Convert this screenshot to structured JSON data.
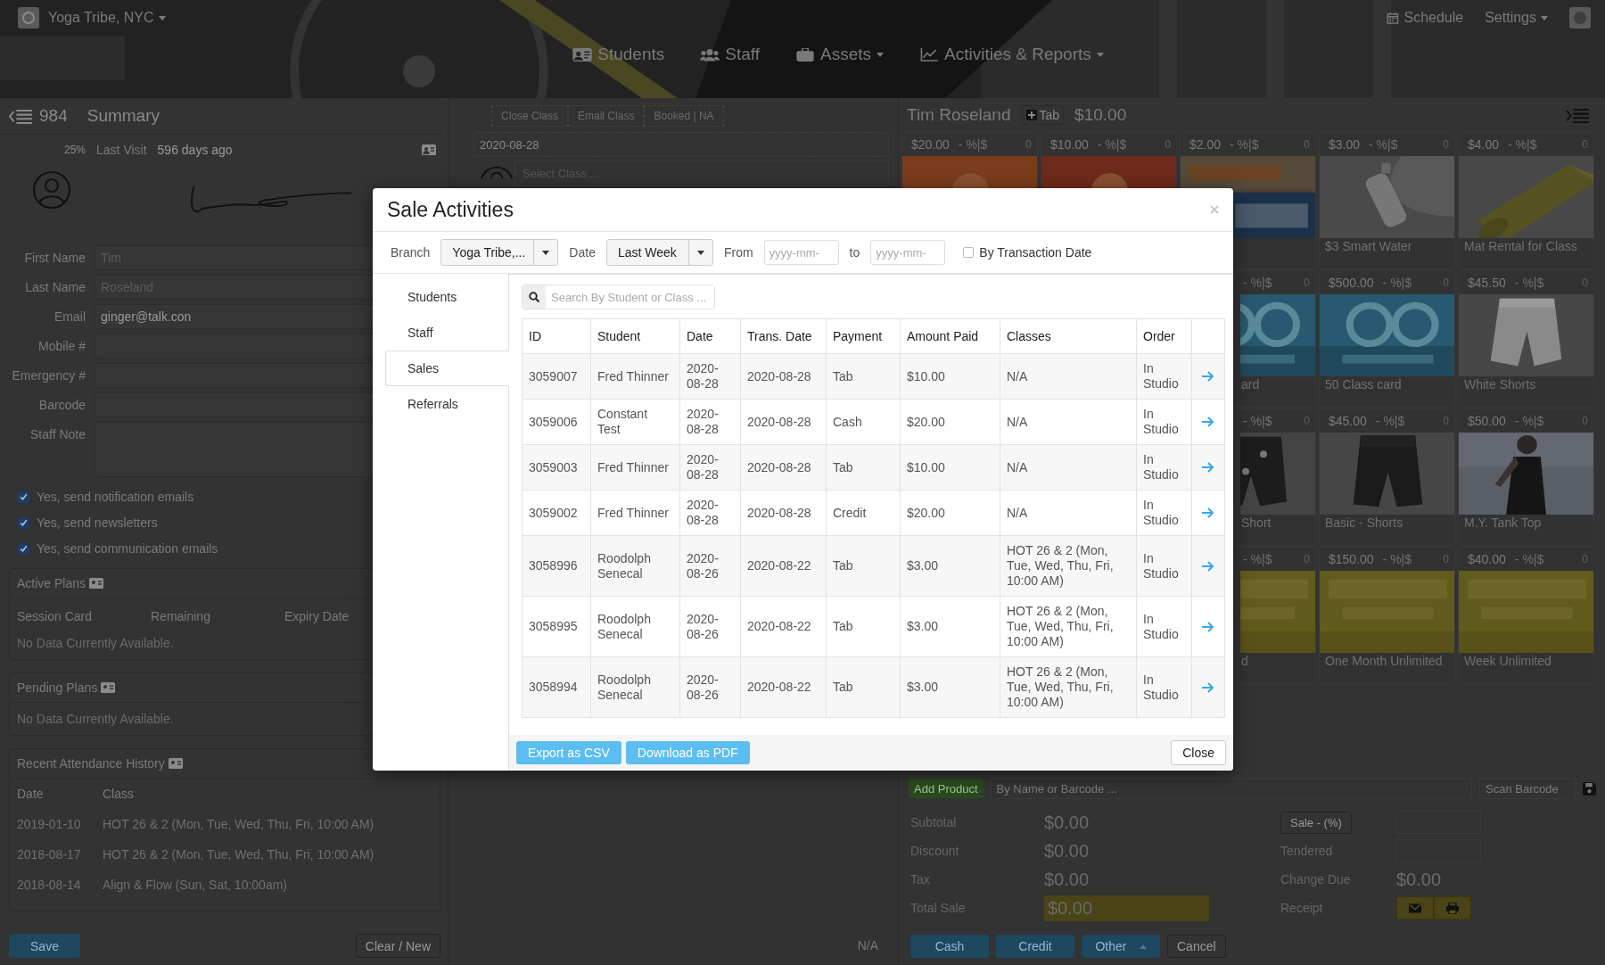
{
  "header": {
    "brand": "Yoga Tribe, NYC",
    "brand_dropdown": true,
    "nav": [
      {
        "label": "Students",
        "dropdown": false
      },
      {
        "label": "Staff",
        "dropdown": false
      },
      {
        "label": "Assets",
        "dropdown": true
      },
      {
        "label": "Activities & Reports",
        "dropdown": true
      }
    ],
    "schedule": "Schedule",
    "settings": "Settings",
    "settings_dropdown": true
  },
  "summary": {
    "count": "984",
    "title": "Summary",
    "percent": "25%",
    "last_visit_label": "Last Visit",
    "last_visit": "596 days ago"
  },
  "profile_fields": [
    {
      "label": "First Name",
      "kind": "input",
      "placeholder": "Tim"
    },
    {
      "label": "Last Name",
      "kind": "input",
      "placeholder": "Roseland"
    },
    {
      "label": "Email",
      "kind": "input",
      "value": "ginger@talk.con"
    },
    {
      "label": "Mobile #",
      "kind": "input"
    },
    {
      "label": "Emergency #",
      "kind": "input"
    },
    {
      "label": "Barcode",
      "kind": "input"
    },
    {
      "label": "Staff Note",
      "kind": "textarea"
    }
  ],
  "options": [
    {
      "label": "Yes, send notification emails",
      "checked": true
    },
    {
      "label": "Yes, send newsletters",
      "checked": true
    },
    {
      "label": "Yes, send communication emails",
      "checked": true
    }
  ],
  "active_plans": {
    "title": "Active Plans",
    "columns": [
      "Session Card",
      "Remaining",
      "Expiry Date"
    ],
    "empty": "No Data Currently Available."
  },
  "pending_plans": {
    "title": "Pending Plans",
    "empty": "No Data Currently Available."
  },
  "attendance": {
    "title": "Recent Attendance History",
    "columns": [
      "Date",
      "Class"
    ],
    "rows": [
      [
        "2019-01-10",
        "HOT 26 & 2 (Mon, Tue, Wed, Thu, Fri, 10:00 AM)"
      ],
      [
        "2018-08-17",
        "HOT 26 & 2 (Mon, Tue, Wed, Thu, Fri, 10:00 AM)"
      ],
      [
        "2018-08-14",
        "Align & Flow (Sun, Sat, 10:00am)"
      ]
    ]
  },
  "left_buttons": {
    "save": "Save",
    "clear": "Clear / New"
  },
  "class_panel": {
    "buttons": [
      "Close Class",
      "Email Class",
      "Booked | NA"
    ],
    "date": "2020-08-28",
    "class_placeholder": "Select Class ...",
    "footer": "N/A"
  },
  "pos": {
    "customer": "Tim Roseland",
    "tab_label": "Tab",
    "balance": "$10.00",
    "tile_rows": [
      [
        {
          "price": "$20.00",
          "discount": "- %|$",
          "count": "0",
          "kind": "full"
        },
        {
          "price": "$10.00",
          "discount": "- %|$",
          "count": "0",
          "kind": "full"
        },
        {
          "price": "$2.00",
          "discount": "- %|$",
          "count": "0",
          "kind": "full"
        },
        {
          "price": "$3.00",
          "discount": "- %|$",
          "count": "0",
          "name": "$3 Smart Water",
          "kind": "full"
        },
        {
          "price": "$4.00",
          "discount": "- %|$",
          "count": "0",
          "name": "Mat Rental for Class",
          "kind": "full"
        }
      ],
      [
        {
          "discount": "- %|$",
          "count": "0",
          "name": "ard",
          "kind": "clipped"
        },
        {
          "price": "$500.00",
          "discount": "- %|$",
          "count": "0",
          "name": "50 Class card",
          "kind": "full"
        },
        {
          "price": "$45.50",
          "discount": "- %|$",
          "count": "0",
          "name": "White Shorts",
          "kind": "full"
        }
      ],
      [
        {
          "discount": "- %|$",
          "count": "0",
          "name": "Short",
          "kind": "clipped"
        },
        {
          "price": "$45.00",
          "discount": "- %|$",
          "count": "0",
          "name": "Basic - Shorts",
          "kind": "full"
        },
        {
          "price": "$50.00",
          "discount": "- %|$",
          "count": "0",
          "name": "M.Y. Tank Top",
          "kind": "full"
        }
      ],
      [
        {
          "discount": "- %|$",
          "count": "0",
          "name": "d",
          "kind": "clipped"
        },
        {
          "price": "$150.00",
          "discount": "- %|$",
          "count": "0",
          "name": "One Month Unlimited",
          "kind": "full"
        },
        {
          "price": "$40.00",
          "discount": "- %|$",
          "count": "0",
          "name": "Week Unlimited",
          "kind": "full"
        }
      ]
    ],
    "add_product": "Add Product",
    "product_placeholder": "By Name or Barcode ...",
    "scan_placeholder": "Scan Barcode",
    "totals": [
      {
        "label": "Subtotal",
        "value": "$0.00",
        "kind": "plain"
      },
      {
        "label": "Discount",
        "value": "$0.00",
        "kind": "plain"
      },
      {
        "label": "Tax",
        "value": "$0.00",
        "kind": "plain"
      },
      {
        "label": "Total Sale",
        "value": "$0.00",
        "kind": "highlight"
      }
    ],
    "side_rows": [
      {
        "kind": "button",
        "label": "Sale - (%)"
      },
      {
        "kind": "input",
        "label": "Tendered"
      },
      {
        "kind": "text",
        "label": "Change Due",
        "value": "$0.00"
      },
      {
        "kind": "receipt",
        "label": "Receipt"
      }
    ],
    "actions": [
      {
        "label": "Cash",
        "kind": "primary",
        "dropdown": false
      },
      {
        "label": "Credit",
        "kind": "primary",
        "dropdown": false
      },
      {
        "label": "Other",
        "kind": "primary",
        "dropdown": true
      },
      {
        "label": "Cancel",
        "kind": "default",
        "dropdown": false
      }
    ]
  },
  "modal": {
    "title": "Sale Activities",
    "branch_label": "Branch",
    "branch": "Yoga Tribe,...",
    "date_label": "Date",
    "date": "Last Week",
    "from_label": "From",
    "from_placeholder": "yyyy-mm-",
    "to_label": "to",
    "to_placeholder": "yyyy-mm-",
    "by_transaction_date": {
      "label": "By Transaction Date",
      "checked": false
    },
    "tabs": [
      {
        "label": "Students",
        "selected": false
      },
      {
        "label": "Staff",
        "selected": false
      },
      {
        "label": "Sales",
        "selected": true
      },
      {
        "label": "Referrals",
        "selected": false
      }
    ],
    "search_placeholder": "Search By Student or Class ...",
    "columns": [
      "ID",
      "Student",
      "Date",
      "Trans. Date",
      "Payment",
      "Amount Paid",
      "Classes",
      "Order"
    ],
    "rows": [
      [
        "3059007",
        "Fred Thinner",
        "2020-08-28",
        "2020-08-28",
        "Tab",
        "$10.00",
        "N/A",
        "In Studio"
      ],
      [
        "3059006",
        "Constant Test",
        "2020-08-28",
        "2020-08-28",
        "Cash",
        "$20.00",
        "N/A",
        "In Studio"
      ],
      [
        "3059003",
        "Fred Thinner",
        "2020-08-28",
        "2020-08-28",
        "Tab",
        "$10.00",
        "N/A",
        "In Studio"
      ],
      [
        "3059002",
        "Fred Thinner",
        "2020-08-28",
        "2020-08-28",
        "Credit",
        "$20.00",
        "N/A",
        "In Studio"
      ],
      [
        "3058996",
        "Roodolph Senecal",
        "2020-08-26",
        "2020-08-22",
        "Tab",
        "$3.00",
        "HOT 26 & 2 (Mon, Tue, Wed, Thu, Fri, 10:00 AM)",
        "In Studio"
      ],
      [
        "3058995",
        "Roodolph Senecal",
        "2020-08-26",
        "2020-08-22",
        "Tab",
        "$3.00",
        "HOT 26 & 2 (Mon, Tue, Wed, Thu, Fri, 10:00 AM)",
        "In Studio"
      ],
      [
        "3058994",
        "Roodolph Senecal",
        "2020-08-26",
        "2020-08-22",
        "Tab",
        "$3.00",
        "HOT 26 & 2 (Mon, Tue, Wed, Thu, Fri, 10:00 AM)",
        "In Studio"
      ]
    ],
    "export": "Export as CSV",
    "download": "Download as PDF",
    "close": "Close"
  }
}
